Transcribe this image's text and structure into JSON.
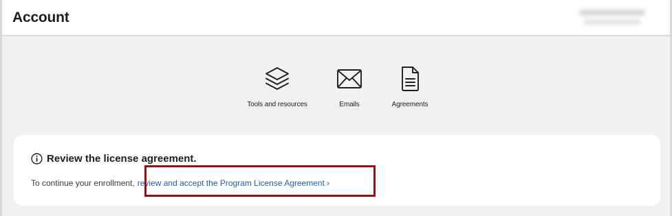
{
  "header": {
    "title": "Account"
  },
  "quick_links": [
    {
      "label": "Tools and resources",
      "icon": "layers-icon"
    },
    {
      "label": "Emails",
      "icon": "envelope-icon"
    },
    {
      "label": "Agreements",
      "icon": "document-icon"
    }
  ],
  "notice": {
    "icon": "info-icon",
    "title": "Review the license agreement.",
    "body_text": "To continue your enrollment,",
    "link_text": "review and accept the Program License Agreement ›"
  },
  "colors": {
    "link": "#1e5fae",
    "highlight_border": "#8e1414",
    "page_background": "#f1f1f3"
  }
}
